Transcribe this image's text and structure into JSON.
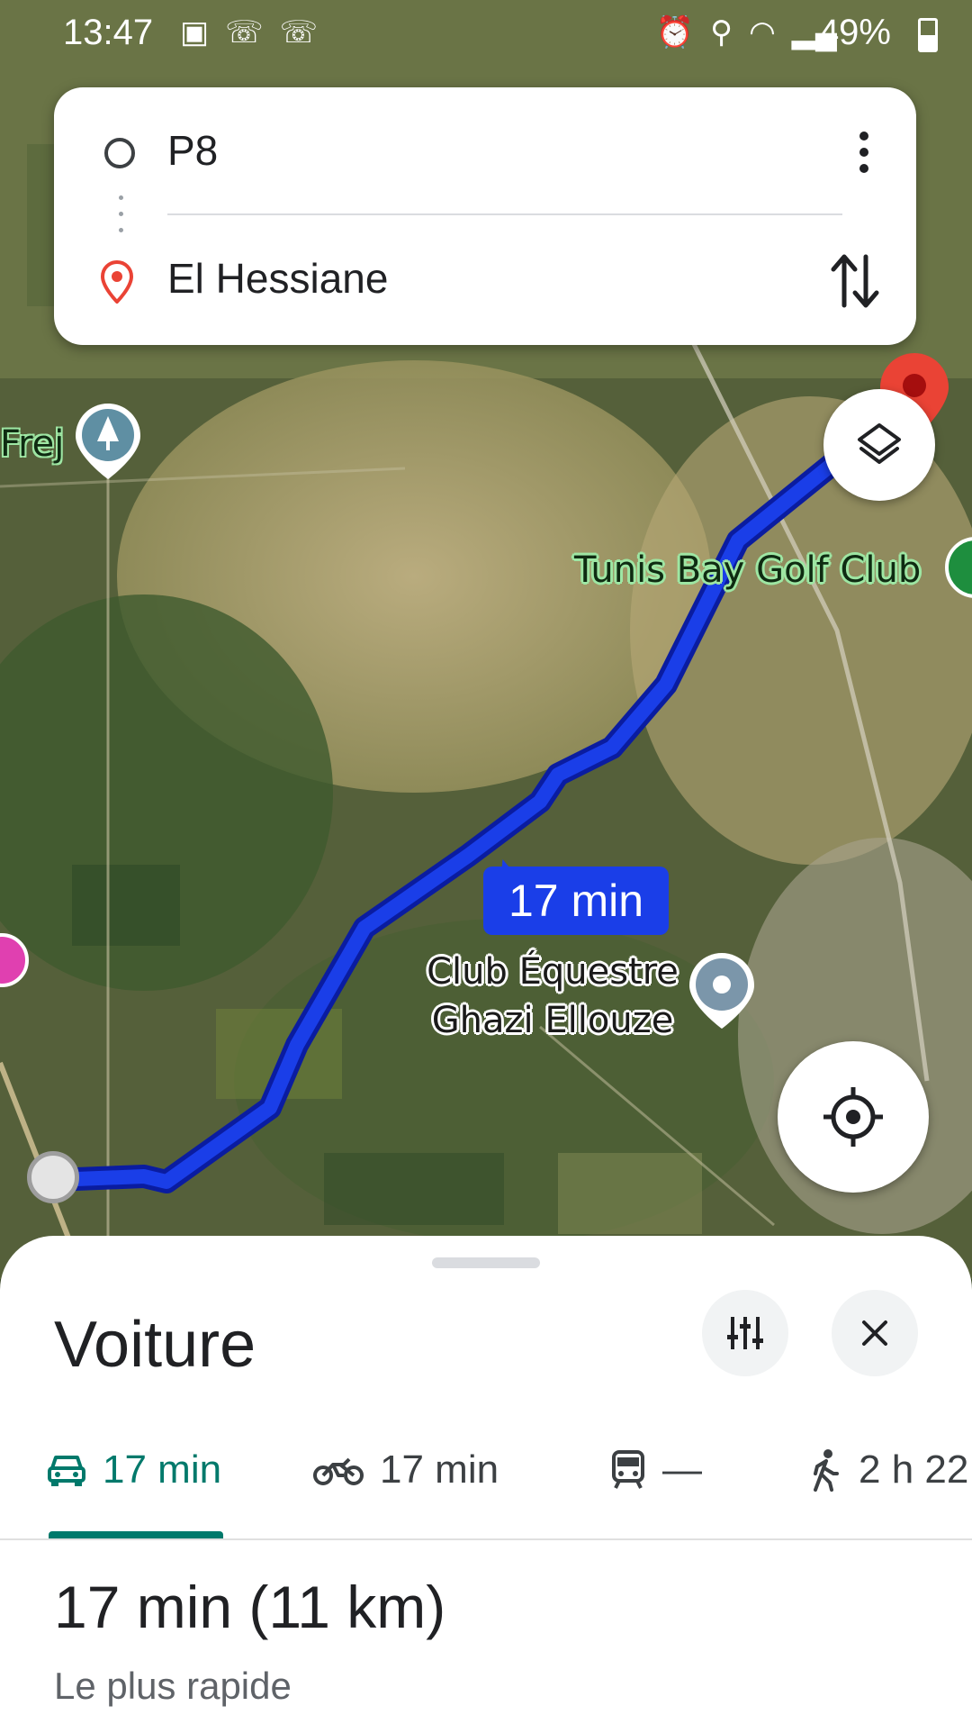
{
  "status_bar": {
    "time": "13:47",
    "battery": "49%"
  },
  "directions": {
    "origin": "P8",
    "destination": "El Hessiane"
  },
  "map": {
    "labels": {
      "golf": "Tunis Bay Golf Club",
      "frej": "Frej",
      "club": "Club Équestre Ghazi Ellouze"
    },
    "route_badge": "17 min",
    "colors": {
      "route": "#1a3ee8",
      "destination_pin": "#ea4335"
    }
  },
  "sheet": {
    "mode_title": "Voiture",
    "tabs": [
      {
        "icon": "car-icon",
        "label": "17 min",
        "selected": true
      },
      {
        "icon": "motorcycle-icon",
        "label": "17 min"
      },
      {
        "icon": "train-icon",
        "label": "—"
      },
      {
        "icon": "walk-icon",
        "label": "2 h 22"
      }
    ],
    "summary": "17 min (11 km)",
    "subtitle": "Le plus rapide",
    "accent": "#00796b"
  }
}
